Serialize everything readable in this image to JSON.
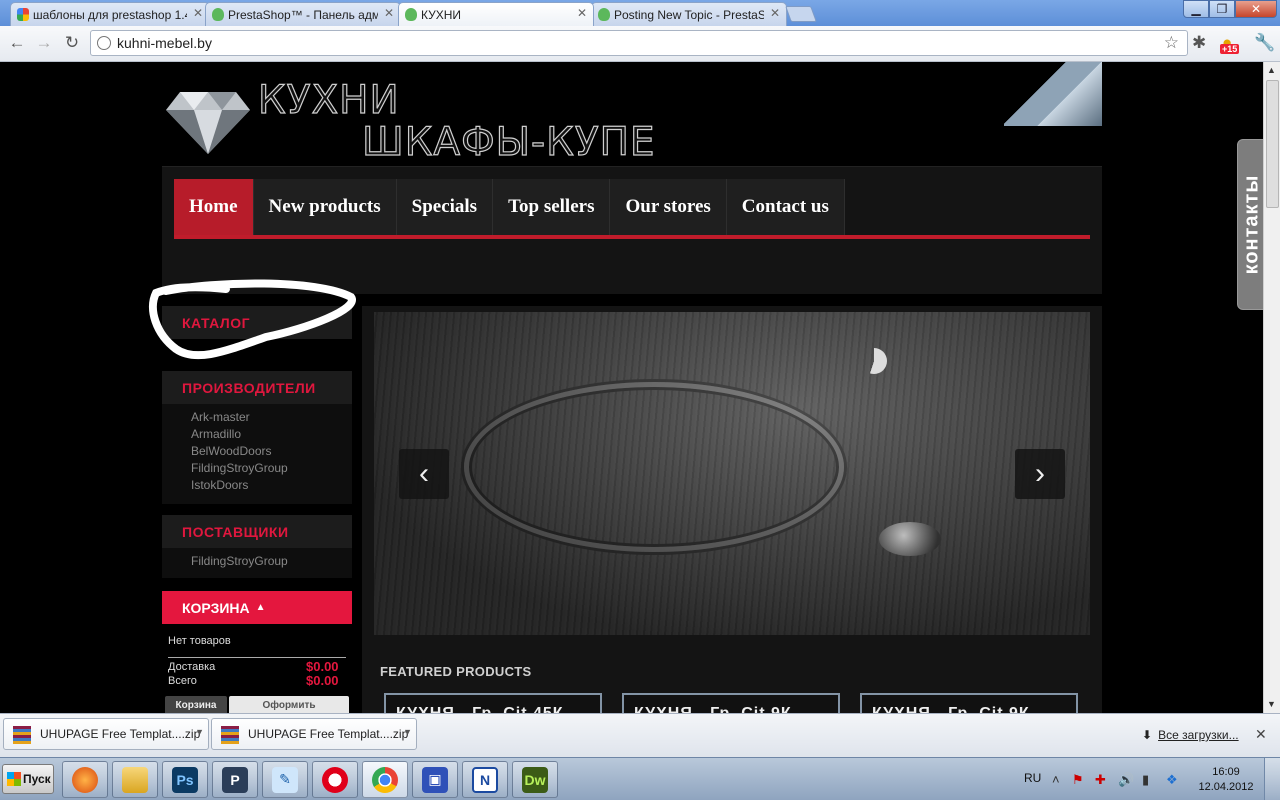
{
  "browser": {
    "tabs": [
      {
        "title": "шаблоны для prestashop 1.4",
        "favicon": "google-icon"
      },
      {
        "title": "PrestaShop™ - Панель админ",
        "favicon": "prestashop-icon"
      },
      {
        "title": "КУХНИ",
        "favicon": "prestashop-icon"
      },
      {
        "title": "Posting New Topic - PrestaSho",
        "favicon": "prestashop-icon"
      }
    ],
    "url": "kuhni-mebel.by",
    "badge": "+15"
  },
  "site": {
    "logo_line1": "КУХНИ",
    "logo_line2": "ШКАФЫ-КУПЕ",
    "menu": [
      "Home",
      "New products",
      "Specials",
      "Top sellers",
      "Our stores",
      "Contact us"
    ],
    "catalog_title": "КАТАЛОГ",
    "manufacturers_title": "ПРОИЗВОДИТЕЛИ",
    "manufacturers": [
      "Ark-master",
      "Armadillo",
      "BelWoodDoors",
      "FildingStroyGroup",
      "IstokDoors"
    ],
    "suppliers_title": "ПОСТАВЩИКИ",
    "suppliers": [
      "FildingStroyGroup"
    ],
    "cart": {
      "title": "КОРЗИНА",
      "empty": "Нет товаров",
      "shipping_label": "Доставка",
      "shipping_value": "$0.00",
      "total_label": "Всего",
      "total_value": "$0.00",
      "cart_button": "Корзина",
      "checkout_button": "Оформить"
    },
    "featured_title": "FEATURED PRODUCTS",
    "products": [
      "КУХНЯ - Гр. Сit 45К",
      "КУХНЯ - Гр. Сit 9К",
      "КУХНЯ - Гр. Сit 9К"
    ],
    "contacts_tab": "контакты",
    "slider_prev": "‹",
    "slider_next": "›"
  },
  "downloads": {
    "items": [
      "UHUPAGE Free Templat....zip",
      "UHUPAGE Free Templat....zip"
    ],
    "all_label": "Все загрузки..."
  },
  "taskbar": {
    "start_label": "Пуск",
    "apps": [
      "firefox-icon",
      "explorer-icon",
      "photoshop-icon",
      "ftp-client-icon",
      "notepad-icon",
      "opera-icon",
      "chrome-icon",
      "save-icon",
      "netbeans-icon",
      "dreamweaver-icon"
    ],
    "lang": "RU",
    "time": "16:09",
    "date": "12.04.2012"
  },
  "colors": {
    "accent_red": "#b71c2a",
    "cart_red": "#e4173e",
    "background": "#000000"
  }
}
